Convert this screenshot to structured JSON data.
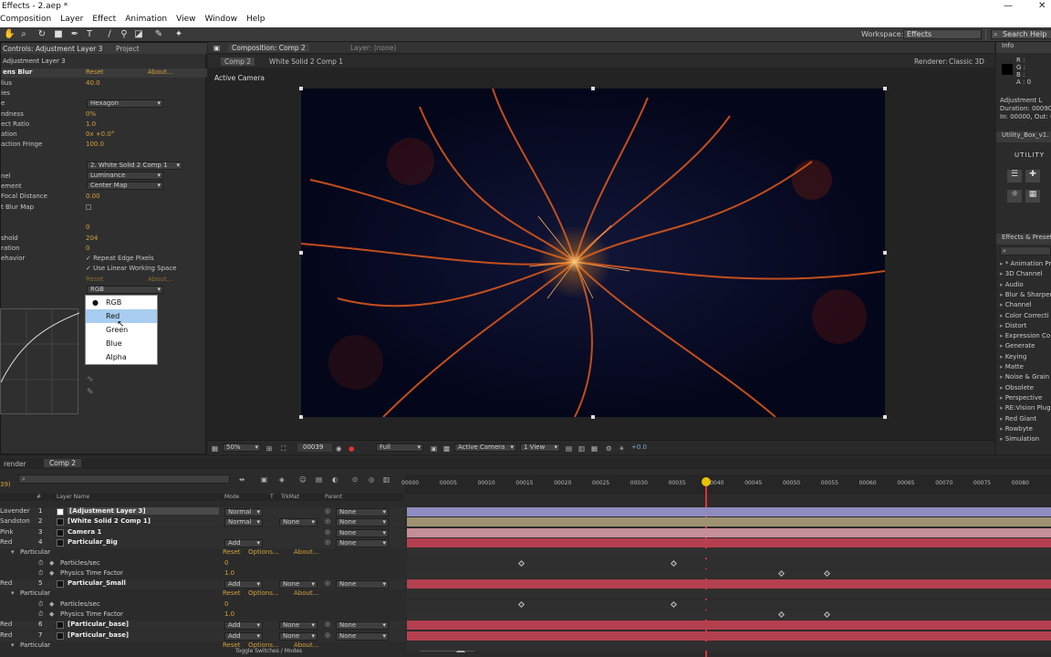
{
  "titlebar": {
    "title": "Effects - 2.aep *",
    "minimize": "—",
    "close": "✕"
  },
  "menu": [
    "Composition",
    "Layer",
    "Effect",
    "Animation",
    "View",
    "Window",
    "Help"
  ],
  "toolbar": {
    "workspace_label": "Workspace:",
    "workspace_value": "Effects",
    "search_placeholder": "Search Help"
  },
  "effects_panel": {
    "tab": "Controls: Adjustment Layer 3",
    "tab2": "Project",
    "subtitle": "Adjustment Layer 3",
    "effect_name": "ens Blur",
    "reset": "Reset",
    "about": "About...",
    "rows": [
      {
        "label": "lius",
        "value": "40.0"
      },
      {
        "label": "ies",
        "value": ""
      },
      {
        "label": "e",
        "value": ""
      },
      {
        "label": "ndness",
        "value": "0%"
      },
      {
        "label": "ect Ratio",
        "value": "1.0"
      },
      {
        "label": "ation",
        "value": "0x +0.0°"
      },
      {
        "label": "action Fringe",
        "value": "100.0"
      },
      {
        "label": "nel",
        "value": ""
      },
      {
        "label": "ement",
        "value": ""
      },
      {
        "label": "Focal Distance",
        "value": "0.00"
      },
      {
        "label": "t Blur Map",
        "value": ""
      },
      {
        "label": "",
        "value": "0"
      },
      {
        "label": "shold",
        "value": "204"
      },
      {
        "label": "ration",
        "value": "0"
      },
      {
        "label": "ehavior",
        "value": ""
      }
    ],
    "iris_shape": "Hexagon",
    "source_layer": "2. White Solid 2 Comp 1",
    "channel": "Luminance",
    "placement": "Center Map",
    "repeat_edge": "Repeat Edge Pixels",
    "linear": "Use Linear Working Space",
    "reset2": "Reset",
    "about2": "About...",
    "channel_select": "RGB",
    "popup": [
      "RGB",
      "Red",
      "Green",
      "Blue",
      "Alpha"
    ]
  },
  "comp_panel": {
    "tab": "Composition: Comp 2",
    "layer_tab": "Layer: (none)",
    "crumb1": "Comp 2",
    "crumb2": "White Solid 2 Comp 1",
    "renderer_label": "Renderer:",
    "renderer_value": "Classic 3D",
    "camera": "Active Camera",
    "bottom": {
      "zoom": "50%",
      "timecode": "00039",
      "quality": "Full",
      "camera": "Active Camera",
      "view": "1 View",
      "exposure": "+0.0"
    }
  },
  "info_panel": {
    "tab": "Info",
    "r": "R :",
    "g": "G :",
    "b": "B :",
    "a": "A : 0",
    "layer": "Adjustment L",
    "duration": "Duration: 00090",
    "inout": "In: 00000, Out: 0",
    "utility": "Utility_Box_v1.",
    "utility_logo": "UTILITY"
  },
  "effects_presets": {
    "tab": "Effects & Presets",
    "items": [
      "* Animation Pr",
      "3D Channel",
      "Audio",
      "Blur & Sharpen",
      "Channel",
      "Color Correcti",
      "Distort",
      "Expression Co",
      "Generate",
      "Keying",
      "Matte",
      "Noise & Grain",
      "Obsolete",
      "Perspective",
      "RE:Vision Plug",
      "Red Giant",
      "Rowbyte",
      "Simulation"
    ]
  },
  "timeline": {
    "tab1": "render",
    "tab2": "Comp 2",
    "timecode": "39)",
    "headers": {
      "num": "#",
      "name": "Layer Name",
      "mode": "Mode",
      "t": "T",
      "trkmat": "TrkMat",
      "parent": "Parent"
    },
    "ruler": [
      "00000",
      "00005",
      "00010",
      "00015",
      "00020",
      "00025",
      "00030",
      "00035",
      "00040",
      "00045",
      "00050",
      "00055",
      "00060",
      "00065",
      "00070",
      "00075",
      "00080"
    ],
    "layers": [
      {
        "color": "Lavender",
        "num": "1",
        "name": "[Adjustment Layer 3]",
        "mode": "Normal",
        "trk": "",
        "parent": "None"
      },
      {
        "color": "Sandston",
        "num": "2",
        "name": "[White Solid 2 Comp 1]",
        "mode": "Normal",
        "trk": "None",
        "parent": "None"
      },
      {
        "color": "Pink",
        "num": "3",
        "name": "Camera 1",
        "mode": "",
        "trk": "",
        "parent": "None"
      },
      {
        "color": "Red",
        "num": "4",
        "name": "Particular_Big",
        "mode": "Add",
        "trk": "",
        "parent": "None"
      },
      {
        "color": "",
        "num": "",
        "name": "Particular",
        "mode": "Reset",
        "trk": "Options...",
        "parent": "About..."
      },
      {
        "color": "",
        "num": "",
        "name": "Particles/sec",
        "mode": "0",
        "trk": "",
        "parent": ""
      },
      {
        "color": "",
        "num": "",
        "name": "Physics Time Factor",
        "mode": "1.0",
        "trk": "",
        "parent": ""
      },
      {
        "color": "Red",
        "num": "5",
        "name": "Particular_Small",
        "mode": "Add",
        "trk": "None",
        "parent": "None"
      },
      {
        "color": "",
        "num": "",
        "name": "Particular",
        "mode": "Reset",
        "trk": "Options...",
        "parent": "About..."
      },
      {
        "color": "",
        "num": "",
        "name": "Particles/sec",
        "mode": "0",
        "trk": "",
        "parent": ""
      },
      {
        "color": "",
        "num": "",
        "name": "Physics Time Factor",
        "mode": "1.0",
        "trk": "",
        "parent": ""
      },
      {
        "color": "Red",
        "num": "6",
        "name": "[Particular_base]",
        "mode": "Add",
        "trk": "None",
        "parent": "None"
      },
      {
        "color": "Red",
        "num": "7",
        "name": "[Particular_base]",
        "mode": "Add",
        "trk": "None",
        "parent": "None"
      },
      {
        "color": "",
        "num": "",
        "name": "Particular",
        "mode": "Reset",
        "trk": "Options...",
        "parent": "About..."
      }
    ],
    "toggle": "Toggle Switches / Modes"
  },
  "colors": {
    "lavender": "#a7a3d8",
    "sandstone": "#b8a77a",
    "pink": "#d79aa8",
    "red": "#b4404f",
    "accent": "#d4a13a",
    "playhead": "#e0303a"
  }
}
